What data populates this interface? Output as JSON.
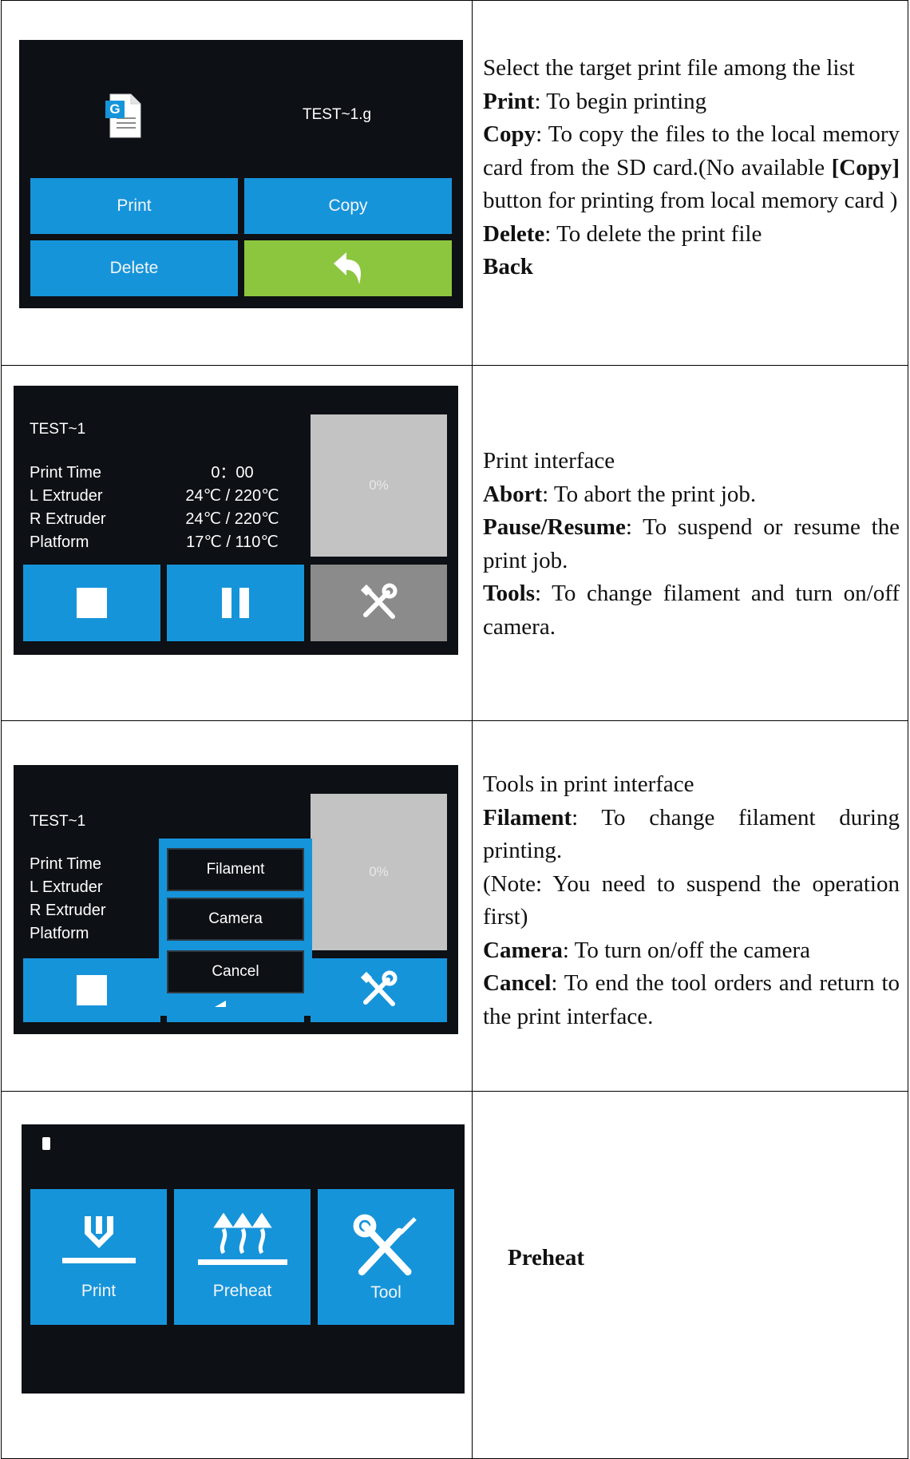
{
  "row1": {
    "file_name": "TEST~1.g",
    "file_icon_letter": "G",
    "buttons": {
      "print": "Print",
      "copy": "Copy",
      "delete": "Delete"
    },
    "desc": {
      "line1": "Select the target print file among the list",
      "print_term": "Print",
      "print_text": ": To begin printing",
      "copy_term": "Copy",
      "copy_text": ": To copy the files to the local memory card from the SD card.(No available",
      "copy_bracket": "[Copy]",
      "copy_text2": "button for printing from local memory card )",
      "delete_term": "Delete",
      "delete_text": ": To delete the print file",
      "back_term": "Back"
    }
  },
  "row2": {
    "title": "TEST~1",
    "labels": [
      "Print Time",
      "L Extruder",
      "R Extruder",
      "Platform"
    ],
    "values": [
      "0：00",
      "24℃ / 220℃",
      "24℃ / 220℃",
      "17℃ / 110℃"
    ],
    "progress": "0%",
    "desc": {
      "line1": "Print interface",
      "abort_term": "Abort",
      "abort_text": ": To abort the print job.",
      "pause_term": "Pause/Resume",
      "pause_text": ": To suspend or resume the print job.",
      "tools_term": "Tools",
      "tools_text": ": To change filament and turn on/off camera."
    }
  },
  "row3": {
    "title": "TEST~1",
    "labels": [
      "Print Time",
      "L Extruder",
      "R Extruder",
      "Platform"
    ],
    "progress": "0%",
    "menu": [
      "Filament",
      "Camera",
      "Cancel"
    ],
    "desc": {
      "line1": "Tools in print interface",
      "filament_term": "Filament",
      "filament_text": ": To change filament during printing.",
      "note": "(Note: You need to suspend the operation first)",
      "camera_term": "Camera",
      "camera_text": ": To turn on/off the camera",
      "cancel_term": "Cancel",
      "cancel_text": ": To end the tool orders and return to the print interface."
    }
  },
  "row4": {
    "tiles": [
      "Print",
      "Preheat",
      "Tool"
    ],
    "desc_term": "Preheat"
  },
  "colors": {
    "screen_bg": "#0d1014",
    "button_blue": "#1694da",
    "back_green": "#8cc63f",
    "tools_gray": "#8b8b8b"
  }
}
